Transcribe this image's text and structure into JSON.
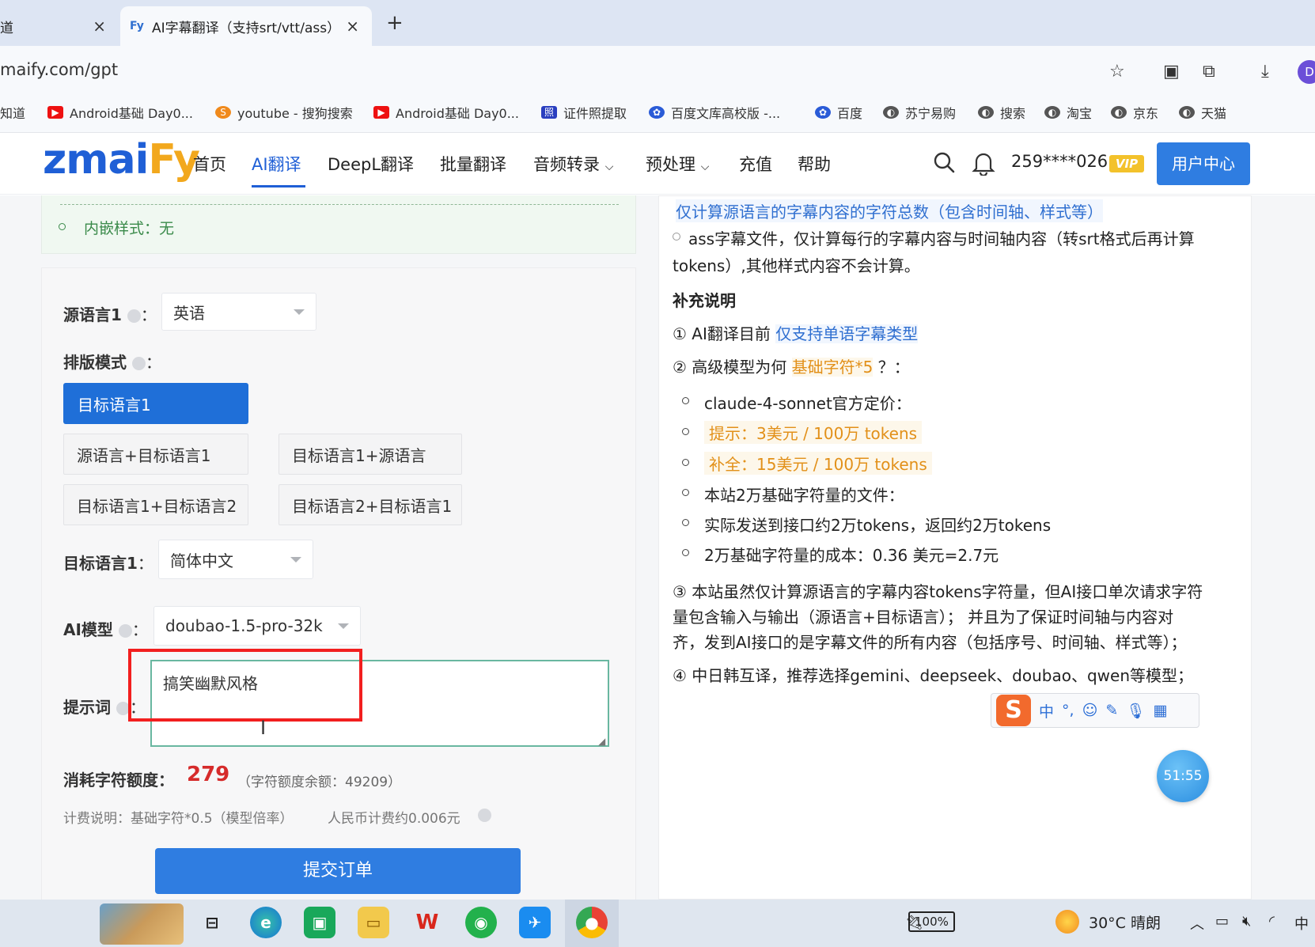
{
  "browser": {
    "tabs": [
      {
        "label": "道"
      },
      {
        "label": "AI字幕翻译（支持srt/vtt/ass）",
        "favicon": "Fy"
      }
    ],
    "new_tab": "+",
    "close": "×",
    "url": "maify.com/gpt",
    "avatar": "D"
  },
  "bookmarks": [
    {
      "label": "知道"
    },
    {
      "label": "Android基础 Day0...",
      "icon": "youtube-icon",
      "color": "#e11"
    },
    {
      "label": "youtube - 搜狗搜索",
      "icon": "sogou-icon",
      "color": "#f08a1c"
    },
    {
      "label": "Android基础 Day0...",
      "icon": "youtube-icon",
      "color": "#e11"
    },
    {
      "label": "证件照提取",
      "icon": "photo-id-icon",
      "color": "#2a3fbf"
    },
    {
      "label": "百度文库高校版 -...",
      "icon": "baidu-paw-icon",
      "color": "#2a5bd7"
    },
    {
      "label": "百度",
      "icon": "baidu-paw-icon",
      "color": "#2a5bd7"
    },
    {
      "label": "苏宁易购",
      "icon": "globe-icon",
      "color": "#555"
    },
    {
      "label": "搜索",
      "icon": "globe-icon",
      "color": "#555"
    },
    {
      "label": "淘宝",
      "icon": "globe-icon",
      "color": "#555"
    },
    {
      "label": "京东",
      "icon": "globe-icon",
      "color": "#555"
    },
    {
      "label": "天猫",
      "icon": "globe-icon",
      "color": "#555"
    }
  ],
  "site": {
    "logo_main": "zmai",
    "logo_accent": "Fy",
    "nav": [
      "首页",
      "AI翻译",
      "DeepL翻译",
      "批量翻译",
      "音频转录",
      "预处理",
      "充值",
      "帮助"
    ],
    "user": "259****026",
    "vip": "VIP",
    "user_center": "用户中心"
  },
  "form": {
    "inline_style": "内嵌样式：无",
    "source_label": "源语言1",
    "source_value": "英语",
    "layout_label": "排版模式",
    "layout_options": [
      "目标语言1",
      "源语言+目标语言1",
      "目标语言1+源语言",
      "目标语言1+目标语言2",
      "目标语言2+目标语言1"
    ],
    "target_label": "目标语言1",
    "target_value": "简体中文",
    "model_label": "AI模型",
    "model_value": "doubao-1.5-pro-32k",
    "prompt_label": "提示词",
    "prompt_value": "搞笑幽默风格",
    "colon": "：",
    "cost_label": "消耗字符额度：",
    "cost_value": "279",
    "cost_remain": "（字符额度余额：49209）",
    "billing": "计费说明：基础字符*0.5（模型倍率）",
    "rmb": "人民币计费约0.006元",
    "submit": "提交订单"
  },
  "help": {
    "line_top": "仅计算源语言的字幕内容的字符总数（包含时间轴、样式等）",
    "ass_line1": "ass字幕文件，仅计算每行的字幕内容与时间轴内容（转srt格式后再计算",
    "ass_line2": "tokens）,其他样式内容不会计算。",
    "supplement_title": "补充说明",
    "item1_prefix": "① AI翻译目前",
    "item1_link": "仅支持单语字幕类型",
    "item2_prefix": "② 高级模型为何",
    "item2_highlight": "基础字符*5",
    "item2_suffix": "？：",
    "bullets": [
      "claude-4-sonnet官方定价：",
      "提示：3美元 / 100万 tokens",
      "补全：15美元 / 100万 tokens",
      "本站2万基础字符量的文件：",
      "实际发送到接口约2万tokens，返回约2万tokens",
      "2万基础字符量的成本：0.36 美元=2.7元"
    ],
    "item3_line1": "③ 本站虽然仅计算源语言的字幕内容tokens字符量，但AI接口单次请求字符",
    "item3_line2": "量包含输入与输出（源语言+目标语言）； 并且为了保证时间轴与内容对",
    "item3_line3": "齐，发到AI接口的是字幕文件的所有内容（包括序号、时间轴、样式等）；",
    "item4": "④ 中日韩互译，推荐选择gemini、deepseek、doubao、qwen等模型；"
  },
  "ime": {
    "logo": "S",
    "lang": "中",
    "items": [
      "punct-icon",
      "emoji-icon",
      "skin-icon",
      "mic-icon",
      "grid-icon"
    ]
  },
  "timer": "51:55",
  "taskbar": {
    "battery": "100%",
    "temperature": "30°C",
    "weather": "晴朗",
    "ime_lang": "中"
  }
}
